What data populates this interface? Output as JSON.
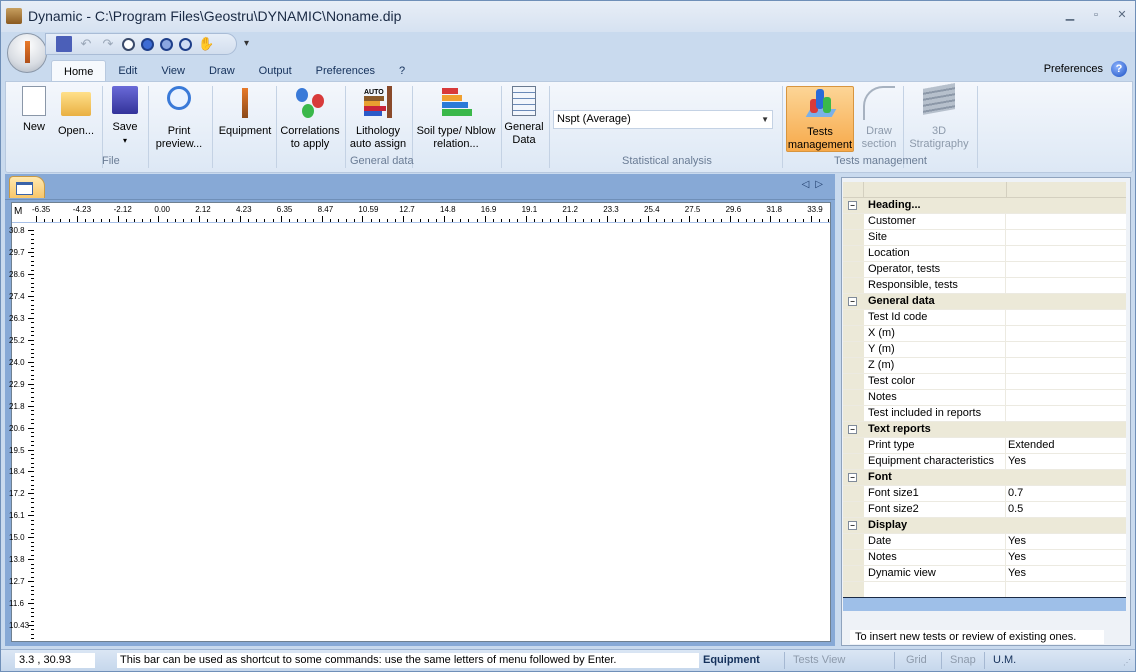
{
  "window": {
    "title": "Dynamic - C:\\Program Files\\Geostru\\DYNAMIC\\Noname.dip",
    "controls": [
      "minimize",
      "maximize",
      "close"
    ]
  },
  "quick_access": {
    "items": [
      "save-icon",
      "undo-icon",
      "redo-icon",
      "zoom-extents-icon",
      "zoom-in-icon",
      "zoom-out-icon",
      "zoom-window-icon",
      "pan-icon"
    ],
    "more": "▾"
  },
  "menu": {
    "tabs": [
      "Home",
      "Edit",
      "View",
      "Draw",
      "Output",
      "Preferences",
      "?"
    ],
    "active_tab": "Home",
    "right_label": "Preferences",
    "help": "?"
  },
  "ribbon": {
    "file": {
      "label": "File",
      "buttons": [
        {
          "label1": "New",
          "label2": ""
        },
        {
          "label1": "Open...",
          "label2": ""
        },
        {
          "label1": "Save",
          "label2": "▾"
        },
        {
          "label1": "Print",
          "label2": "preview..."
        }
      ]
    },
    "general_data": {
      "label": "General data",
      "buttons": [
        {
          "label1": "Equipment",
          "label2": ""
        },
        {
          "label1": "Correlations",
          "label2": "to apply"
        },
        {
          "label1": "Lithology",
          "label2": "auto assign"
        },
        {
          "label1": "Soil type/ Nblow",
          "label2": "relation..."
        },
        {
          "label1": "General",
          "label2": "Data"
        }
      ]
    },
    "statistical_analysis": {
      "label": "Statistical analysis",
      "combo_value": "Nspt (Average)"
    },
    "tests_management": {
      "label": "Tests management",
      "buttons": [
        {
          "label1": "Tests",
          "label2": "management",
          "state": "selected"
        },
        {
          "label1": "Draw",
          "label2": "section",
          "state": "disabled"
        },
        {
          "label1": "3D",
          "label2": "Stratigraphy",
          "state": "disabled"
        }
      ]
    }
  },
  "canvas": {
    "unit": "M",
    "h_ruler": [
      "-6.35",
      "-4.23",
      "-2.12",
      "0.00",
      "2.12",
      "4.23",
      "6.35",
      "8.47",
      "10.59",
      "12.7",
      "14.8",
      "16.9",
      "19.1",
      "21.2",
      "23.3",
      "25.4",
      "27.5",
      "29.6",
      "31.8",
      "33.9"
    ],
    "v_ruler": [
      "30.8",
      "29.7",
      "28.6",
      "27.4",
      "26.3",
      "25.2",
      "24.0",
      "22.9",
      "21.8",
      "20.6",
      "19.5",
      "18.4",
      "17.2",
      "16.1",
      "15.0",
      "13.8",
      "12.7",
      "11.6",
      "10.43"
    ]
  },
  "properties": {
    "categories": [
      {
        "name": "Heading...",
        "rows": [
          {
            "name": "Customer",
            "value": ""
          },
          {
            "name": "Site",
            "value": ""
          },
          {
            "name": "Location",
            "value": ""
          },
          {
            "name": "Operator, tests",
            "value": ""
          },
          {
            "name": "Responsible, tests",
            "value": ""
          }
        ]
      },
      {
        "name": "General data",
        "rows": [
          {
            "name": "Test Id code",
            "value": ""
          },
          {
            "name": "X (m)",
            "value": ""
          },
          {
            "name": "Y (m)",
            "value": ""
          },
          {
            "name": "Z (m)",
            "value": ""
          },
          {
            "name": "Test color",
            "value": ""
          },
          {
            "name": "Notes",
            "value": ""
          },
          {
            "name": "Test included in reports",
            "value": ""
          }
        ]
      },
      {
        "name": "Text reports",
        "rows": [
          {
            "name": "Print type",
            "value": "Extended"
          },
          {
            "name": "Equipment characteristics",
            "value": "Yes"
          }
        ]
      },
      {
        "name": "Font",
        "rows": [
          {
            "name": "Font size1",
            "value": "0.7"
          },
          {
            "name": "Font size2",
            "value": "0.5"
          }
        ]
      },
      {
        "name": "Display",
        "rows": [
          {
            "name": "Date",
            "value": "Yes"
          },
          {
            "name": "Notes",
            "value": "Yes"
          },
          {
            "name": "Dynamic view",
            "value": "Yes"
          }
        ]
      }
    ],
    "description": "To insert new tests or review of existing ones."
  },
  "statusbar": {
    "coords": "3.3 , 30.93",
    "command_hint": "This bar can be used as shortcut to some commands: use the same letters of menu followed by Enter.",
    "equipment": "Equipment",
    "tests_view": "Tests View",
    "grid": "Grid",
    "snap": "Snap",
    "um": "U.M."
  }
}
